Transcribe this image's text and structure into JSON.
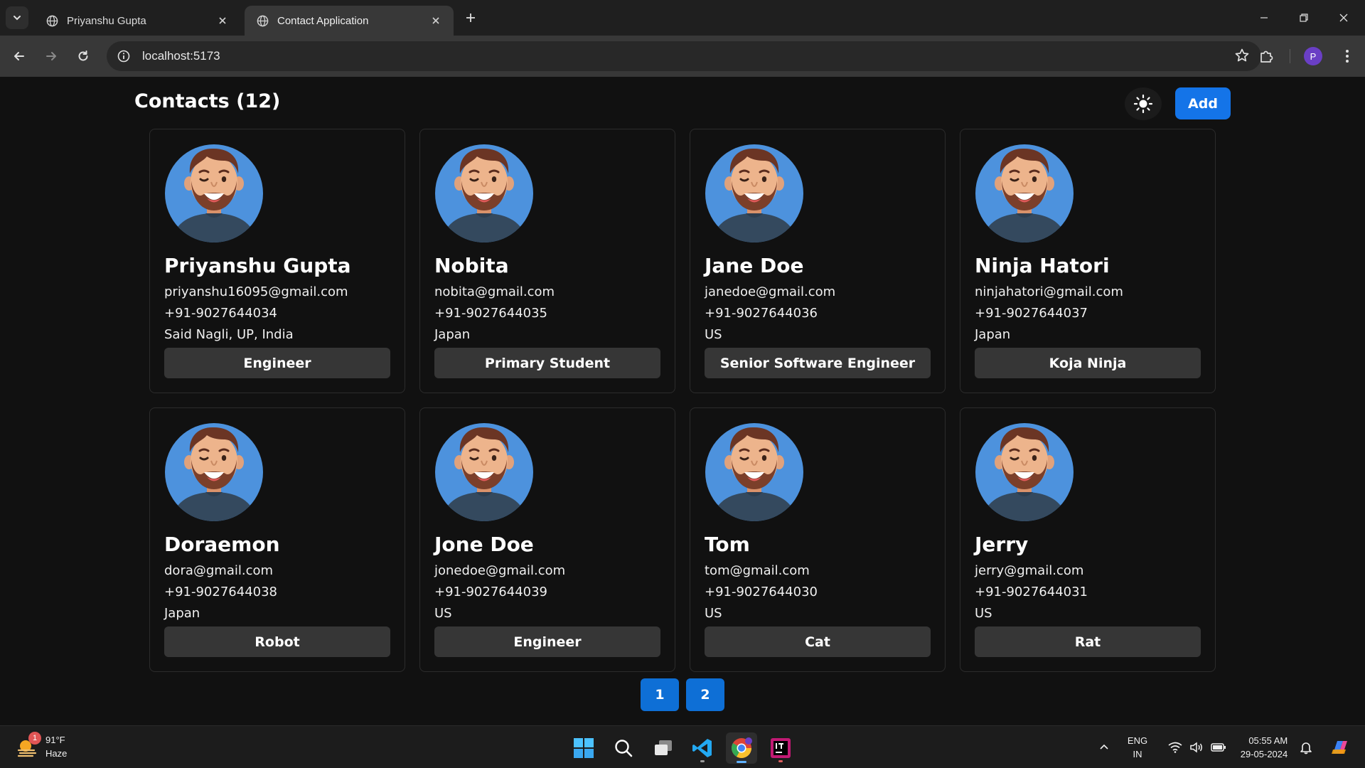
{
  "browser": {
    "tabs": [
      {
        "title": "Priyanshu Gupta",
        "active": false
      },
      {
        "title": "Contact Application",
        "active": true
      }
    ],
    "url": "localhost:5173",
    "profile_initial": "P"
  },
  "app": {
    "title": "Contacts (12)",
    "add_label": "Add",
    "theme_icon": "sun-icon",
    "accent_color": "#1474e8"
  },
  "contacts": [
    {
      "name": "Priyanshu Gupta",
      "email": "priyanshu16095@gmail.com",
      "phone": "+91-9027644034",
      "address": "Said Nagli, UP, India",
      "tag": "Engineer"
    },
    {
      "name": "Nobita",
      "email": "nobita@gmail.com",
      "phone": "+91-9027644035",
      "address": "Japan",
      "tag": "Primary Student"
    },
    {
      "name": "Jane Doe",
      "email": "janedoe@gmail.com",
      "phone": "+91-9027644036",
      "address": "US",
      "tag": "Senior Software Engineer"
    },
    {
      "name": "Ninja Hatori",
      "email": "ninjahatori@gmail.com",
      "phone": "+91-9027644037",
      "address": "Japan",
      "tag": "Koja Ninja"
    },
    {
      "name": "Doraemon",
      "email": "dora@gmail.com",
      "phone": "+91-9027644038",
      "address": "Japan",
      "tag": "Robot"
    },
    {
      "name": "Jone Doe",
      "email": "jonedoe@gmail.com",
      "phone": "+91-9027644039",
      "address": "US",
      "tag": "Engineer"
    },
    {
      "name": "Tom",
      "email": "tom@gmail.com",
      "phone": "+91-9027644030",
      "address": "US",
      "tag": "Cat"
    },
    {
      "name": "Jerry",
      "email": "jerry@gmail.com",
      "phone": "+91-9027644031",
      "address": "US",
      "tag": "Rat"
    }
  ],
  "pagination": {
    "pages": [
      "1",
      "2"
    ]
  },
  "taskbar": {
    "weather_temp": "91°F",
    "weather_desc": "Haze",
    "weather_badge": "1",
    "lang_top": "ENG",
    "lang_bottom": "IN",
    "time": "05:55 AM",
    "date": "29-05-2024"
  }
}
